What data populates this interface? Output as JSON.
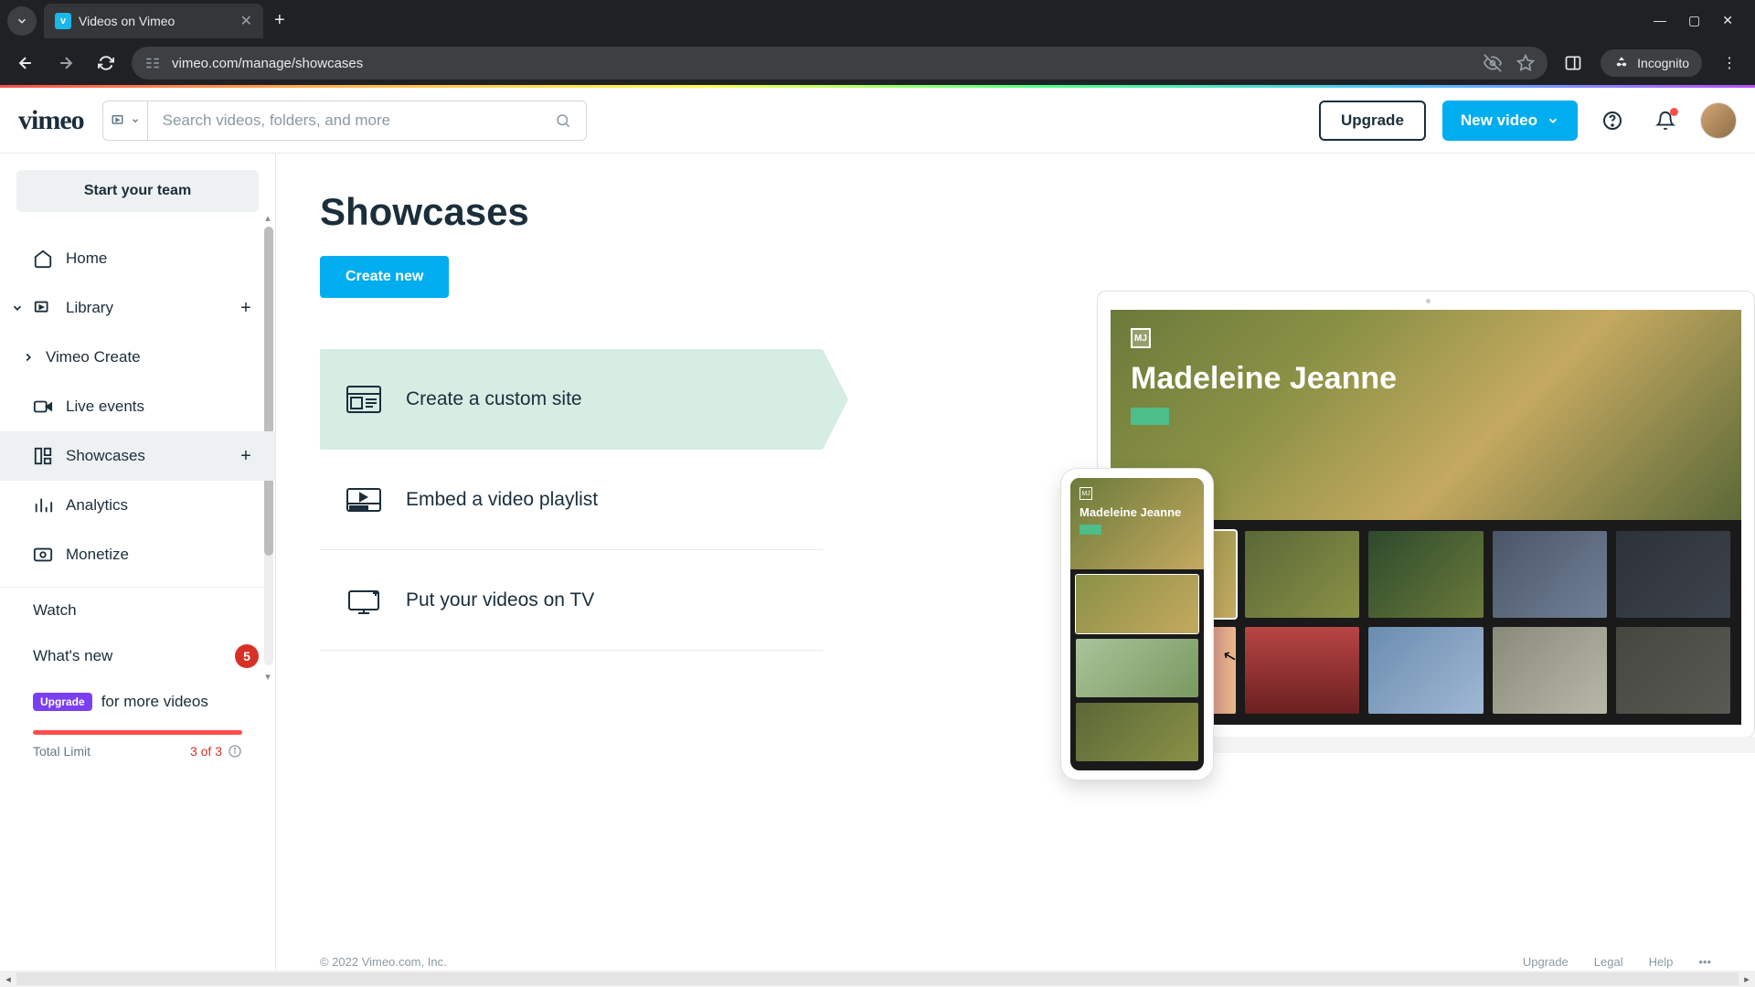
{
  "browser": {
    "tab_title": "Videos on Vimeo",
    "url": "vimeo.com/manage/showcases",
    "incognito_label": "Incognito"
  },
  "header": {
    "logo_text": "vimeo",
    "search_placeholder": "Search videos, folders, and more",
    "upgrade_label": "Upgrade",
    "new_video_label": "New video"
  },
  "sidebar": {
    "start_team_label": "Start your team",
    "items": {
      "home": "Home",
      "library": "Library",
      "vimeo_create": "Vimeo Create",
      "live_events": "Live events",
      "showcases": "Showcases",
      "analytics": "Analytics",
      "monetize": "Monetize",
      "watch": "Watch",
      "whats_new": "What's new"
    },
    "whats_new_count": "5",
    "upgrade_pill": "Upgrade",
    "upgrade_suffix": "for more videos",
    "total_limit_label": "Total Limit",
    "total_limit_value": "3 of 3"
  },
  "main": {
    "title": "Showcases",
    "create_new_label": "Create new",
    "features": {
      "custom_site": "Create a custom site",
      "embed_playlist": "Embed a video playlist",
      "tv": "Put your videos on TV"
    },
    "preview": {
      "hero_title": "Madeleine Jeanne",
      "phone_title": "Madeleine Jeanne"
    }
  },
  "footer": {
    "copyright": "© 2022 Vimeo.com, Inc.",
    "links": {
      "upgrade": "Upgrade",
      "legal": "Legal",
      "help": "Help"
    }
  }
}
